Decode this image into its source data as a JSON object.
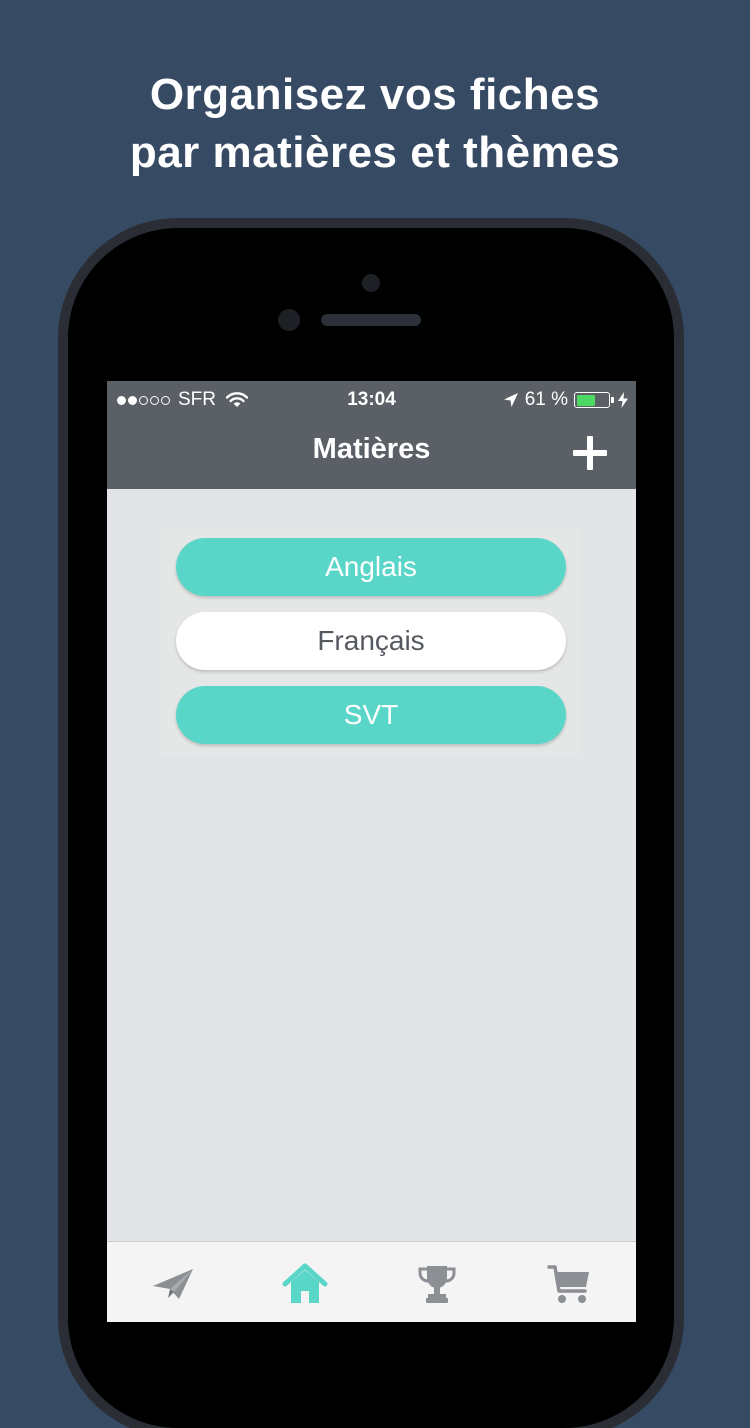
{
  "headline": {
    "line1": "Organisez vos fiches",
    "line2": "par matières et thèmes"
  },
  "status_bar": {
    "carrier": "SFR",
    "time": "13:04",
    "battery_text": "61 %",
    "battery_level": 0.61,
    "signal_bars_filled": 2,
    "signal_bars_total": 5
  },
  "nav": {
    "title": "Matières",
    "add_icon": "plus-icon"
  },
  "subjects": [
    {
      "label": "Anglais",
      "style": "teal"
    },
    {
      "label": "Français",
      "style": "white"
    },
    {
      "label": "SVT",
      "style": "teal"
    }
  ],
  "tabs": [
    {
      "icon": "paper-plane-icon",
      "active": false
    },
    {
      "icon": "home-icon",
      "active": true
    },
    {
      "icon": "trophy-icon",
      "active": false
    },
    {
      "icon": "cart-icon",
      "active": false
    }
  ],
  "colors": {
    "background": "#364a63",
    "bar": "#5b5f66",
    "accent": "#5ad6c8",
    "tab_inactive": "#8c8f93",
    "battery": "#4cd964"
  }
}
